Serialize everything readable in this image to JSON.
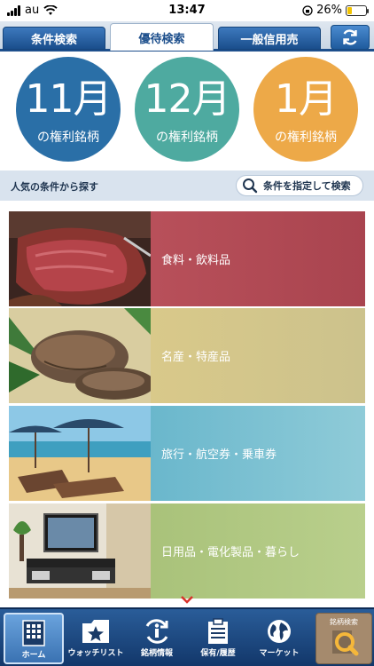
{
  "status_bar": {
    "carrier": "au",
    "time": "13:47",
    "battery": "26%",
    "battery_level": 0.26
  },
  "tabs": [
    {
      "label": "条件検索",
      "active": false
    },
    {
      "label": "優待検索",
      "active": true
    },
    {
      "label": "一般信用売",
      "active": false
    }
  ],
  "months": [
    {
      "month": "11月",
      "caption": "の権利銘柄",
      "color": "#2a6fa7"
    },
    {
      "month": "12月",
      "caption": "の権利銘柄",
      "color": "#4eaaa0"
    },
    {
      "month": "1月",
      "caption": "の権利銘柄",
      "color": "#eda948"
    }
  ],
  "search": {
    "label": "人気の条件から探す",
    "button": "条件を指定して検索"
  },
  "categories": [
    {
      "label": "食料・飲料品",
      "icon": "steak-photo"
    },
    {
      "label": "名産・特産品",
      "icon": "mushroom-photo"
    },
    {
      "label": "旅行・航空券・乗車券",
      "icon": "beach-photo"
    },
    {
      "label": "日用品・電化製品・暮らし",
      "icon": "living-room-photo"
    }
  ],
  "bottom_nav": [
    {
      "label": "ホーム",
      "icon": "home-grid-icon",
      "active": true
    },
    {
      "label": "ウォッチリスト",
      "icon": "folder-star-icon",
      "active": false
    },
    {
      "label": "銘柄情報",
      "icon": "info-refresh-icon",
      "active": false
    },
    {
      "label": "保有/履歴",
      "icon": "clipboard-icon",
      "active": false
    },
    {
      "label": "マーケット",
      "icon": "globe-icon",
      "active": false
    }
  ],
  "nav_search": {
    "label": "銘柄検索",
    "icon": "magnifier-icon"
  }
}
